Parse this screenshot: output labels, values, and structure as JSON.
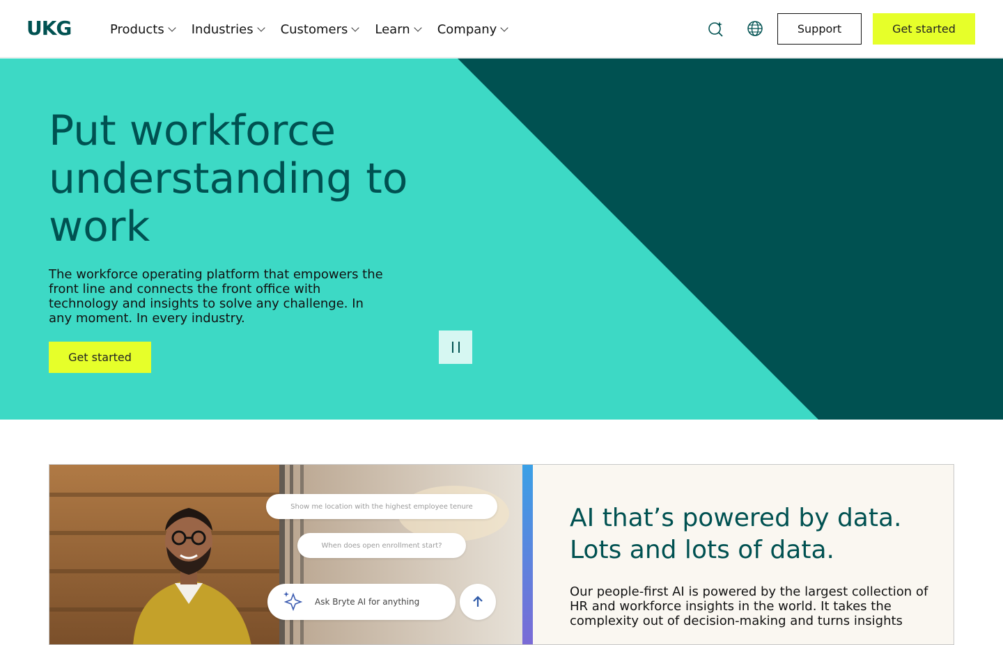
{
  "header": {
    "logo": "UKG",
    "nav": [
      {
        "label": "Products"
      },
      {
        "label": "Industries"
      },
      {
        "label": "Customers"
      },
      {
        "label": "Learn"
      },
      {
        "label": "Company"
      }
    ],
    "support_label": "Support",
    "get_started_label": "Get started"
  },
  "hero": {
    "title": "Put workforce understanding to work",
    "description": "The workforce operating platform that empowers the front line and connects the front office with technology and insights to solve any challenge. In any moment. In every industry.",
    "cta_label": "Get started"
  },
  "feature_card": {
    "title": "AI that’s powered by data. Lots and lots of data.",
    "description": "Our people-first AI is powered by the largest collection of HR and workforce insights in the world. It takes the complexity out of decision-making and turns insights",
    "chat": {
      "prompt_1": "Show me location with the highest employee tenure",
      "prompt_2": "When does open enrollment start?",
      "ask_placeholder": "Ask Bryte AI for anything"
    }
  },
  "colors": {
    "brand_dark": "#005151",
    "hero_teal": "#3dd9c5",
    "cta_yellow": "#e6ff2a"
  }
}
